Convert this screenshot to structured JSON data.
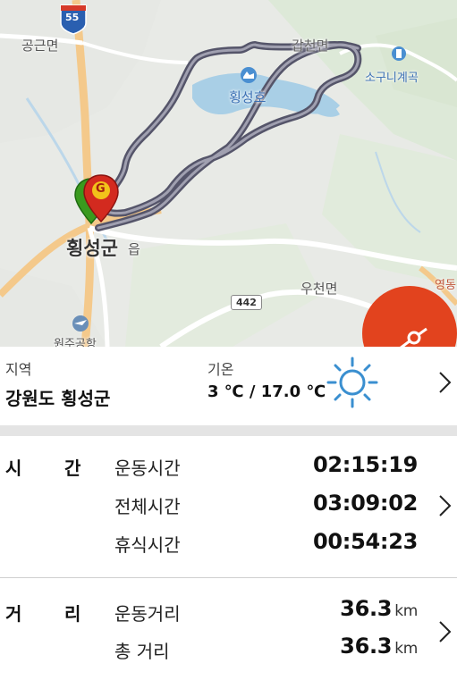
{
  "map": {
    "labels": {
      "gongeun": "공근면",
      "hoengseong_county": "횡성군",
      "eup": "읍",
      "hoengseong_lake": "횡성호",
      "sogunigyegok": "소구니계곡",
      "ucheon": "우천면",
      "wonju_airport": "원주공항",
      "gapcheon": "갑천면",
      "east_road": "영동"
    },
    "roads": {
      "route_55": "55",
      "route_442": "442"
    },
    "markers": {
      "goal": "G"
    },
    "colors": {
      "route": "#6a6a7a",
      "marker_red": "#d32a1f",
      "marker_green": "#3a9a1e",
      "fab": "#e2431e"
    }
  },
  "region": {
    "label": "지역",
    "value": "강원도 횡성군"
  },
  "weather": {
    "label": "기온",
    "value": "3 ℃ / 17.0 ℃",
    "icon": "sun-icon"
  },
  "time": {
    "header_left": "시",
    "header_right": "간",
    "rows": [
      {
        "label": "운동시간",
        "value": "02:15:19"
      },
      {
        "label": "전체시간",
        "value": "03:09:02"
      },
      {
        "label": "휴식시간",
        "value": "00:54:23"
      }
    ]
  },
  "distance": {
    "header_left": "거",
    "header_right": "리",
    "rows": [
      {
        "label": "운동거리",
        "value": "36.3",
        "unit": "km"
      },
      {
        "label": "총 거리",
        "value": "36.3",
        "unit": "km"
      }
    ]
  }
}
